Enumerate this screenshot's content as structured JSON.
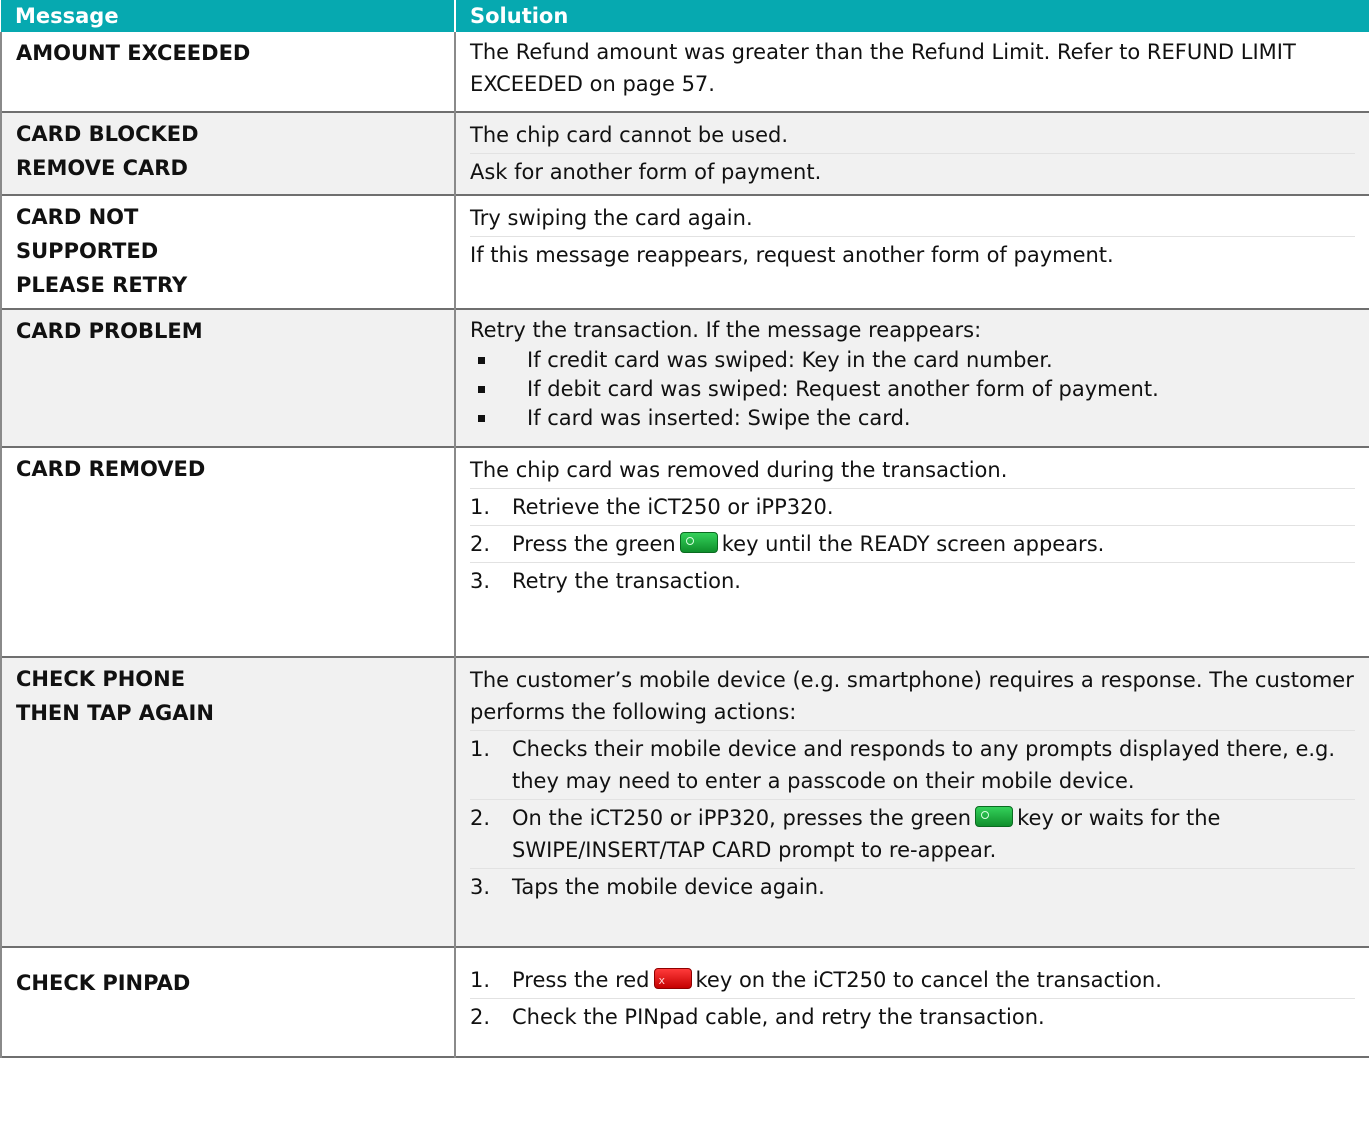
{
  "header": {
    "message": "Message",
    "solution": "Solution"
  },
  "rows": [
    {
      "message": [
        "AMOUNT EXCEEDED"
      ],
      "text": "The Refund amount was greater than the Refund Limit. Refer to REFUND LIMIT EXCEEDED on page 57."
    },
    {
      "message": [
        "CARD BLOCKED",
        "REMOVE CARD"
      ],
      "p1": "The chip card cannot be used.",
      "p2": "Ask for another form of payment."
    },
    {
      "message": [
        "CARD NOT",
        "SUPPORTED",
        "PLEASE RETRY"
      ],
      "p1": "Try swiping the card again.",
      "p2": "If this message reappears, request another form of payment."
    },
    {
      "message": [
        "CARD PROBLEM"
      ],
      "intro": "Retry the transaction. If the message reappears:",
      "bullets": [
        "If credit card was swiped: Key in the card number.",
        "If debit card was swiped: Request another form of payment.",
        "If card was inserted: Swipe the card."
      ]
    },
    {
      "message": [
        "CARD REMOVED"
      ],
      "intro": "The chip card was removed during the transaction.",
      "steps": [
        {
          "num": "1.",
          "text": "Retrieve the iCT250 or iPP320."
        },
        {
          "num": "2.",
          "before": "Press the green",
          "after": "key until the READY screen appears.",
          "key": "green-key-icon"
        },
        {
          "num": "3.",
          "text": "Retry the transaction."
        }
      ]
    },
    {
      "message": [
        "CHECK PHONE",
        "THEN TAP AGAIN"
      ],
      "intro": "The customer’s mobile device (e.g. smartphone) requires a response. The customer performs the following actions:",
      "steps": [
        {
          "num": "1.",
          "text": "Checks their mobile device and responds to any prompts displayed there, e.g. they may need to enter a passcode on their mobile device."
        },
        {
          "num": "2.",
          "before": "On the iCT250 or iPP320, presses the green",
          "after": "key or waits for the SWIPE/INSERT/TAP CARD prompt to re-appear.",
          "key": "green-key-icon"
        },
        {
          "num": "3.",
          "text": "Taps the mobile device again."
        }
      ]
    },
    {
      "message": [
        "CHECK PINPAD"
      ],
      "steps": [
        {
          "num": "1.",
          "before": "Press the red",
          "after": "key on the iCT250 to cancel the transaction.",
          "key": "red-key-icon"
        },
        {
          "num": "2.",
          "text": "Check the PINpad cable, and retry the transaction."
        }
      ]
    }
  ],
  "colors": {
    "header_bg": "#06a9b0",
    "header_text": "#ffffff",
    "alt_row_bg": "#f1f1f1",
    "green_key": "#1fb343",
    "red_key": "#e41010"
  }
}
